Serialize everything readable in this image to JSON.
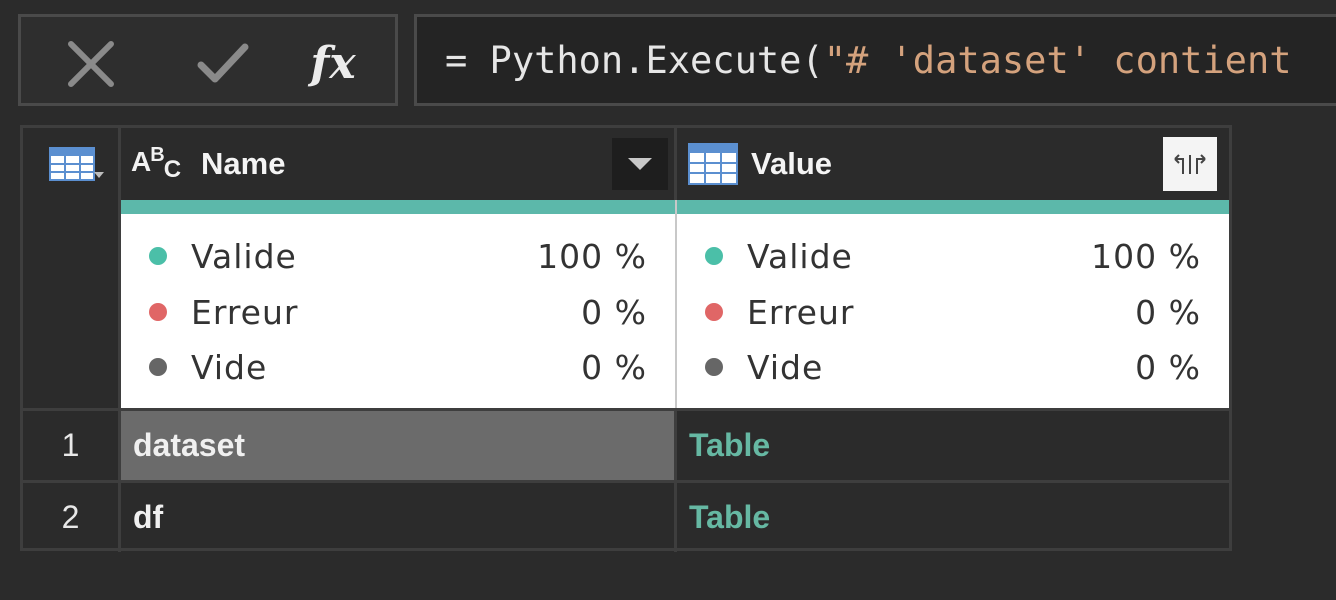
{
  "formula_bar": {
    "cancel_icon": "close-icon",
    "commit_icon": "checkmark-icon",
    "insert_function_label": "fx",
    "formula_prefix": "= Python.Execute(",
    "formula_string": "\"# 'dataset' contient"
  },
  "grid": {
    "corner_icon": "table-menu-icon",
    "columns": [
      {
        "type_icon": "text-type-icon",
        "type_label": {
          "a": "A",
          "b": "B",
          "c": "C"
        },
        "label": "Name",
        "action_icon": "chevron-down-icon",
        "profile": [
          {
            "label": "Valide",
            "value": "100 %",
            "color": "#4bbfa8"
          },
          {
            "label": "Erreur",
            "value": "0 %",
            "color": "#e06666"
          },
          {
            "label": "Vide",
            "value": "0 %",
            "color": "#666666"
          }
        ]
      },
      {
        "type_icon": "table-type-icon",
        "label": "Value",
        "action_icon": "expand-columns-icon",
        "profile": [
          {
            "label": "Valide",
            "value": "100 %",
            "color": "#4bbfa8"
          },
          {
            "label": "Erreur",
            "value": "0 %",
            "color": "#e06666"
          },
          {
            "label": "Vide",
            "value": "0 %",
            "color": "#666666"
          }
        ]
      }
    ],
    "quality_bar_color": "#5cb8aa",
    "rows": [
      {
        "num": "1",
        "name": "dataset",
        "value": "Table",
        "selected": true
      },
      {
        "num": "2",
        "name": "df",
        "value": "Table",
        "selected": false
      }
    ]
  }
}
